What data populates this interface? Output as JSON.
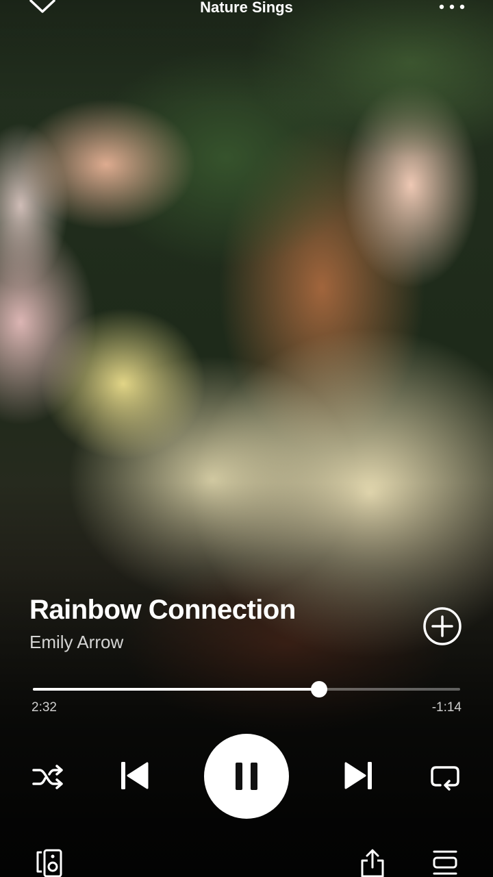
{
  "header": {
    "context_title": "Nature Sings",
    "collapse_icon": "chevron-down-icon",
    "more_icon": "more-horizontal-icon"
  },
  "track": {
    "title": "Rainbow Connection",
    "artist": "Emily Arrow",
    "add_icon": "plus-circle-icon"
  },
  "playback": {
    "elapsed": "2:32",
    "remaining": "-1:14",
    "progress_fraction": 0.67,
    "state": "playing"
  },
  "controls": {
    "shuffle_icon": "shuffle-icon",
    "previous_icon": "skip-previous-icon",
    "play_pause_icon": "pause-icon",
    "next_icon": "skip-next-icon",
    "repeat_icon": "repeat-icon"
  },
  "footer": {
    "devices_icon": "connect-device-icon",
    "share_icon": "share-icon",
    "queue_icon": "queue-icon"
  },
  "colors": {
    "foreground": "#ffffff",
    "play_button_bg": "#ffffff",
    "play_button_icon": "#111111",
    "progress_track": "rgba(255,255,255,0.35)"
  }
}
